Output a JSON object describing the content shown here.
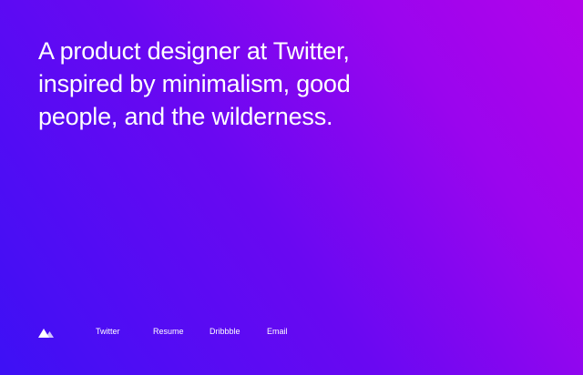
{
  "hero": {
    "headline_lines": [
      "A product designer at Twitter,",
      "inspired by minimalism, good",
      "people, and the wilderness."
    ]
  },
  "footer": {
    "logo_icon": "mountain-logo-icon",
    "links": [
      {
        "label": "Twitter"
      },
      {
        "label": "Resume"
      },
      {
        "label": "Dribbble"
      },
      {
        "label": "Email"
      }
    ]
  },
  "colors": {
    "gradient_start": "#3d10f5",
    "gradient_end": "#b303ea",
    "text": "#ffffff"
  }
}
